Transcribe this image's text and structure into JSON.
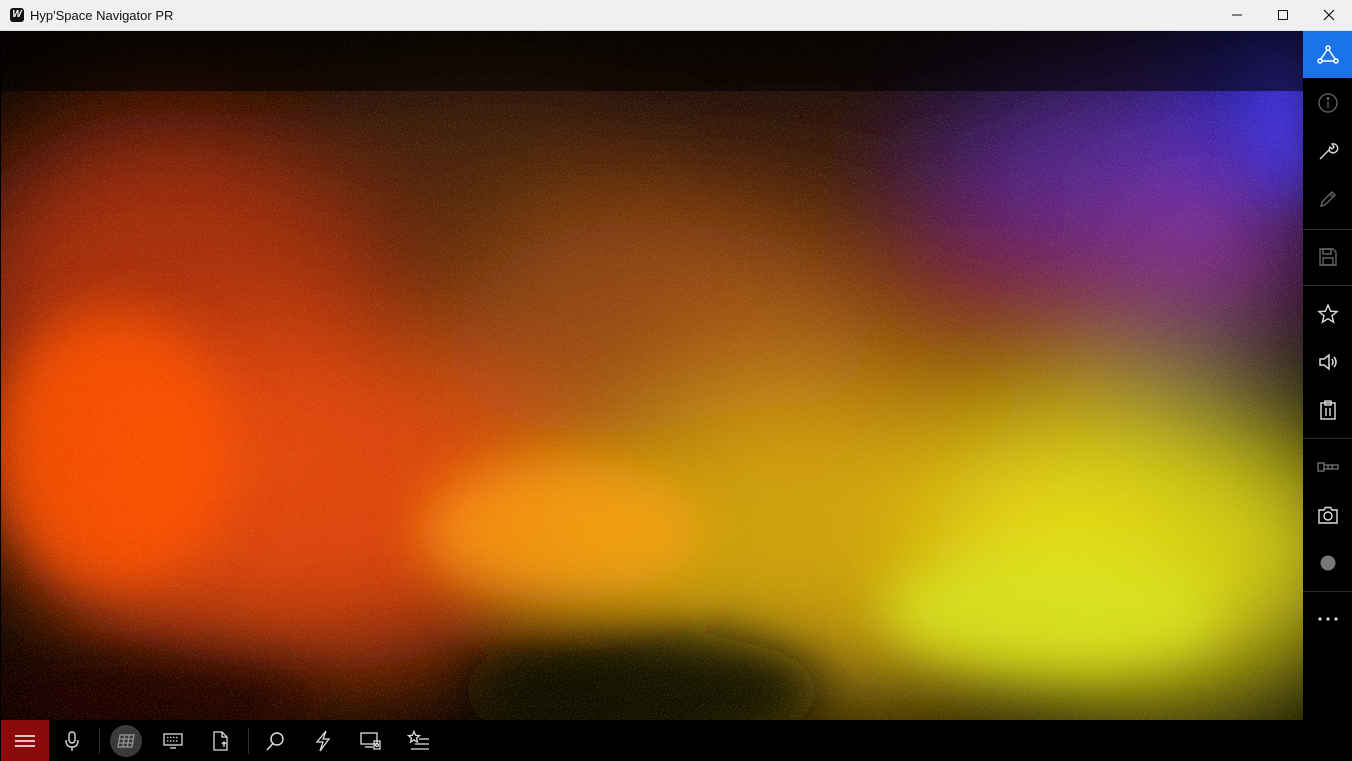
{
  "window": {
    "title": "Hyp'Space Navigator PR",
    "logo_letter": "W"
  },
  "titlebar_buttons": [
    "minimize-icon",
    "maximize-icon",
    "close-icon"
  ],
  "right_toolbar": [
    "network-icon",
    "info-icon",
    "wrench-icon",
    "pencil-icon",
    "save-icon",
    "star-icon",
    "volume-icon",
    "clipboard-icon",
    "film-tool-icon",
    "camera-icon",
    "record-icon",
    "more-icon"
  ],
  "bottom_toolbar": [
    "hamburger-menu-icon",
    "microphone-icon",
    "grid-icon",
    "keyboard-icon",
    "file-upload-icon",
    "search-icon",
    "lightning-icon",
    "media-settings-icon",
    "favorites-list-icon"
  ],
  "colors": {
    "titlebar_bg": "#f0f0f0",
    "active_blue": "#1a73e8",
    "menu_red": "#8b0a0a",
    "toolbar_bg": "#000000"
  }
}
